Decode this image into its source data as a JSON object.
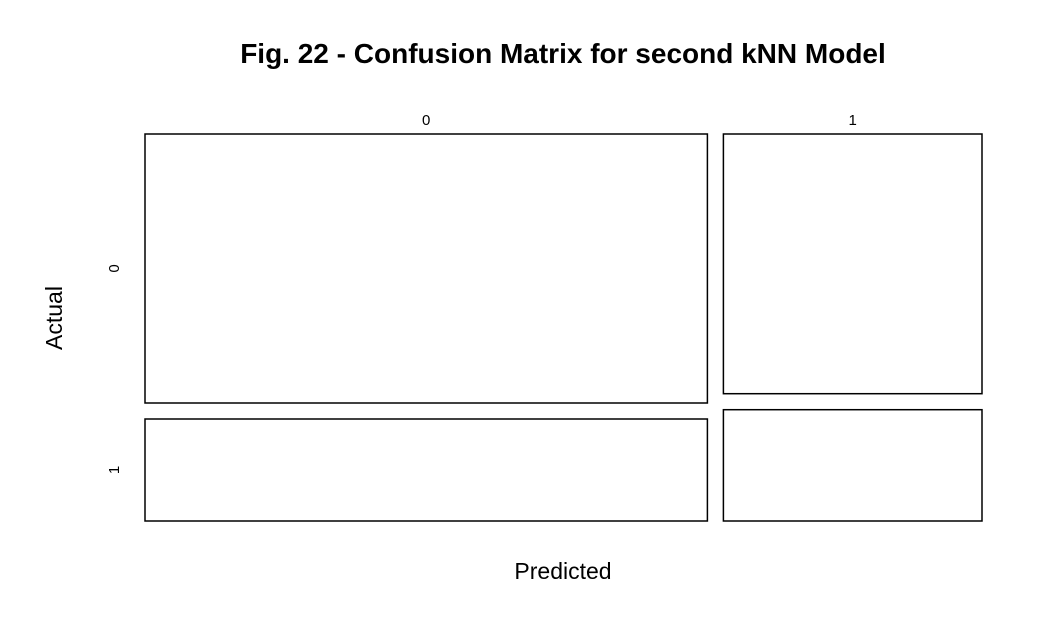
{
  "chart_data": {
    "type": "mosaic",
    "title": "Fig. 22 - Confusion Matrix for second kNN Model",
    "xlabel": "Predicted",
    "ylabel": "Actual",
    "predicted_levels": [
      "0",
      "1"
    ],
    "actual_levels": [
      "0",
      "1"
    ],
    "column_proportions": [
      0.685,
      0.315
    ],
    "row_proportions_within_column": [
      {
        "predicted": "0",
        "actual_0": 0.725,
        "actual_1": 0.275
      },
      {
        "predicted": "1",
        "actual_0": 0.7,
        "actual_1": 0.3
      }
    ],
    "colors": {
      "cell_fill": "#ffffff",
      "cell_stroke": "#000000",
      "text": "#000000"
    }
  }
}
